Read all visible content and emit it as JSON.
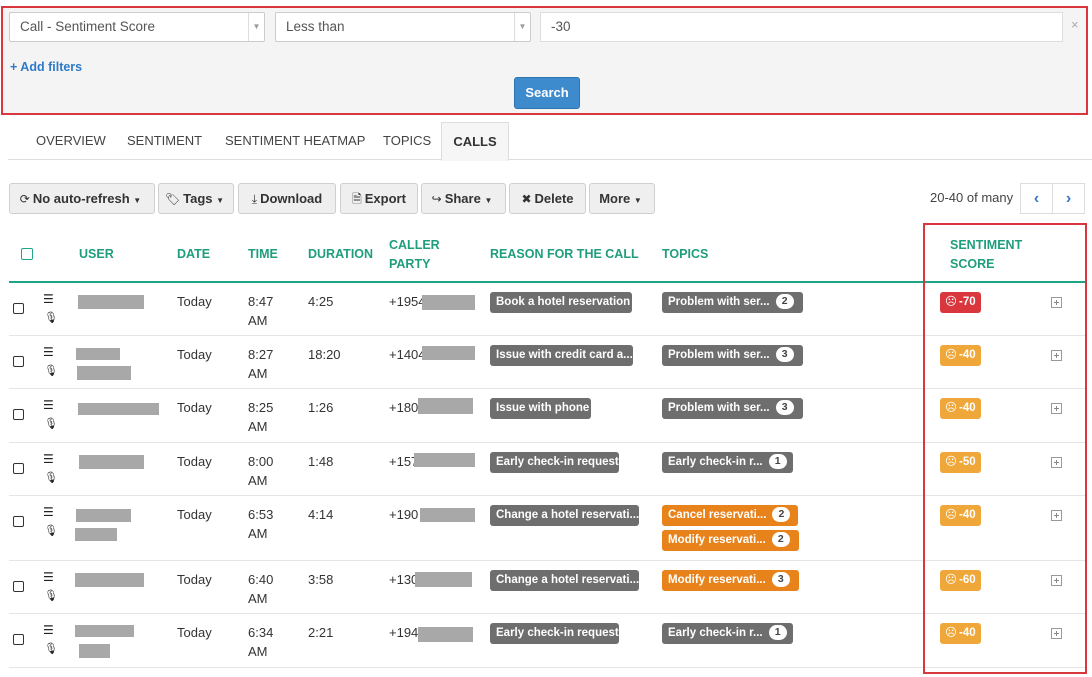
{
  "filter": {
    "field": "Call - Sentiment Score",
    "operator": "Less than",
    "value": "-30",
    "clear_icon": "×",
    "add_filters": "+ Add filters",
    "search_label": "Search"
  },
  "tabs": [
    "OVERVIEW",
    "SENTIMENT",
    "SENTIMENT HEATMAP",
    "TOPICS",
    "CALLS"
  ],
  "active_tab": "CALLS",
  "toolbar": {
    "auto_refresh": "No auto-refresh",
    "tags": "Tags",
    "download": "Download",
    "export": "Export",
    "share": "Share",
    "delete": "Delete",
    "more": "More",
    "pagination": "20-40 of many"
  },
  "columns": {
    "user": "USER",
    "date": "DATE",
    "time": "TIME",
    "duration": "DURATION",
    "caller_line1": "CALLER",
    "caller_line2": "PARTY",
    "reason": "REASON FOR THE CALL",
    "topics": "TOPICS",
    "sentiment_line1": "SENTIMENT",
    "sentiment_line2": "SCORE"
  },
  "rows": [
    {
      "date": "Today",
      "time1": "8:47",
      "time2": "AM",
      "duration": "4:25",
      "caller": "+1954",
      "reason": "Book a hotel reservation",
      "topics": [
        {
          "label": "Problem with ser...",
          "count": "2",
          "color": "grey"
        }
      ],
      "score": "-70",
      "score_color": "#d9363e"
    },
    {
      "date": "Today",
      "time1": "8:27",
      "time2": "AM",
      "duration": "18:20",
      "caller": "+1404",
      "reason": "Issue with credit card a...",
      "topics": [
        {
          "label": "Problem with ser...",
          "count": "3",
          "color": "grey"
        }
      ],
      "score": "-40",
      "score_color": "#efa73a"
    },
    {
      "date": "Today",
      "time1": "8:25",
      "time2": "AM",
      "duration": "1:26",
      "caller": "+180",
      "reason": "Issue with phone",
      "topics": [
        {
          "label": "Problem with ser...",
          "count": "3",
          "color": "grey"
        }
      ],
      "score": "-40",
      "score_color": "#efa73a"
    },
    {
      "date": "Today",
      "time1": "8:00",
      "time2": "AM",
      "duration": "1:48",
      "caller": "+157",
      "reason": "Early check-in request",
      "topics": [
        {
          "label": "Early check-in r...",
          "count": "1",
          "color": "grey"
        }
      ],
      "score": "-50",
      "score_color": "#efa73a"
    },
    {
      "date": "Today",
      "time1": "6:53",
      "time2": "AM",
      "duration": "4:14",
      "caller": "+190",
      "reason": "Change a hotel reservati...",
      "topics": [
        {
          "label": "Cancel reservati...",
          "count": "2",
          "color": "orange"
        },
        {
          "label": "Modify reservati...",
          "count": "2",
          "color": "orange"
        }
      ],
      "score": "-40",
      "score_color": "#efa73a"
    },
    {
      "date": "Today",
      "time1": "6:40",
      "time2": "AM",
      "duration": "3:58",
      "caller": "+130",
      "reason": "Change a hotel reservati...",
      "topics": [
        {
          "label": "Modify reservati...",
          "count": "3",
          "color": "orange"
        }
      ],
      "score": "-60",
      "score_color": "#efa73a"
    },
    {
      "date": "Today",
      "time1": "6:34",
      "time2": "AM",
      "duration": "2:21",
      "caller": "+194",
      "reason": "Early check-in request",
      "topics": [
        {
          "label": "Early check-in r...",
          "count": "1",
          "color": "grey"
        }
      ],
      "score": "-40",
      "score_color": "#efa73a"
    }
  ],
  "icons": {
    "refresh": "refresh-icon",
    "tag": "tag-icon",
    "download": "download-icon",
    "export": "file-export-icon",
    "share": "share-icon",
    "delete": "close-icon",
    "list": "list-icon",
    "mic": "microphone-icon",
    "sad_face": "frown-icon",
    "expand": "plus-square-icon"
  }
}
